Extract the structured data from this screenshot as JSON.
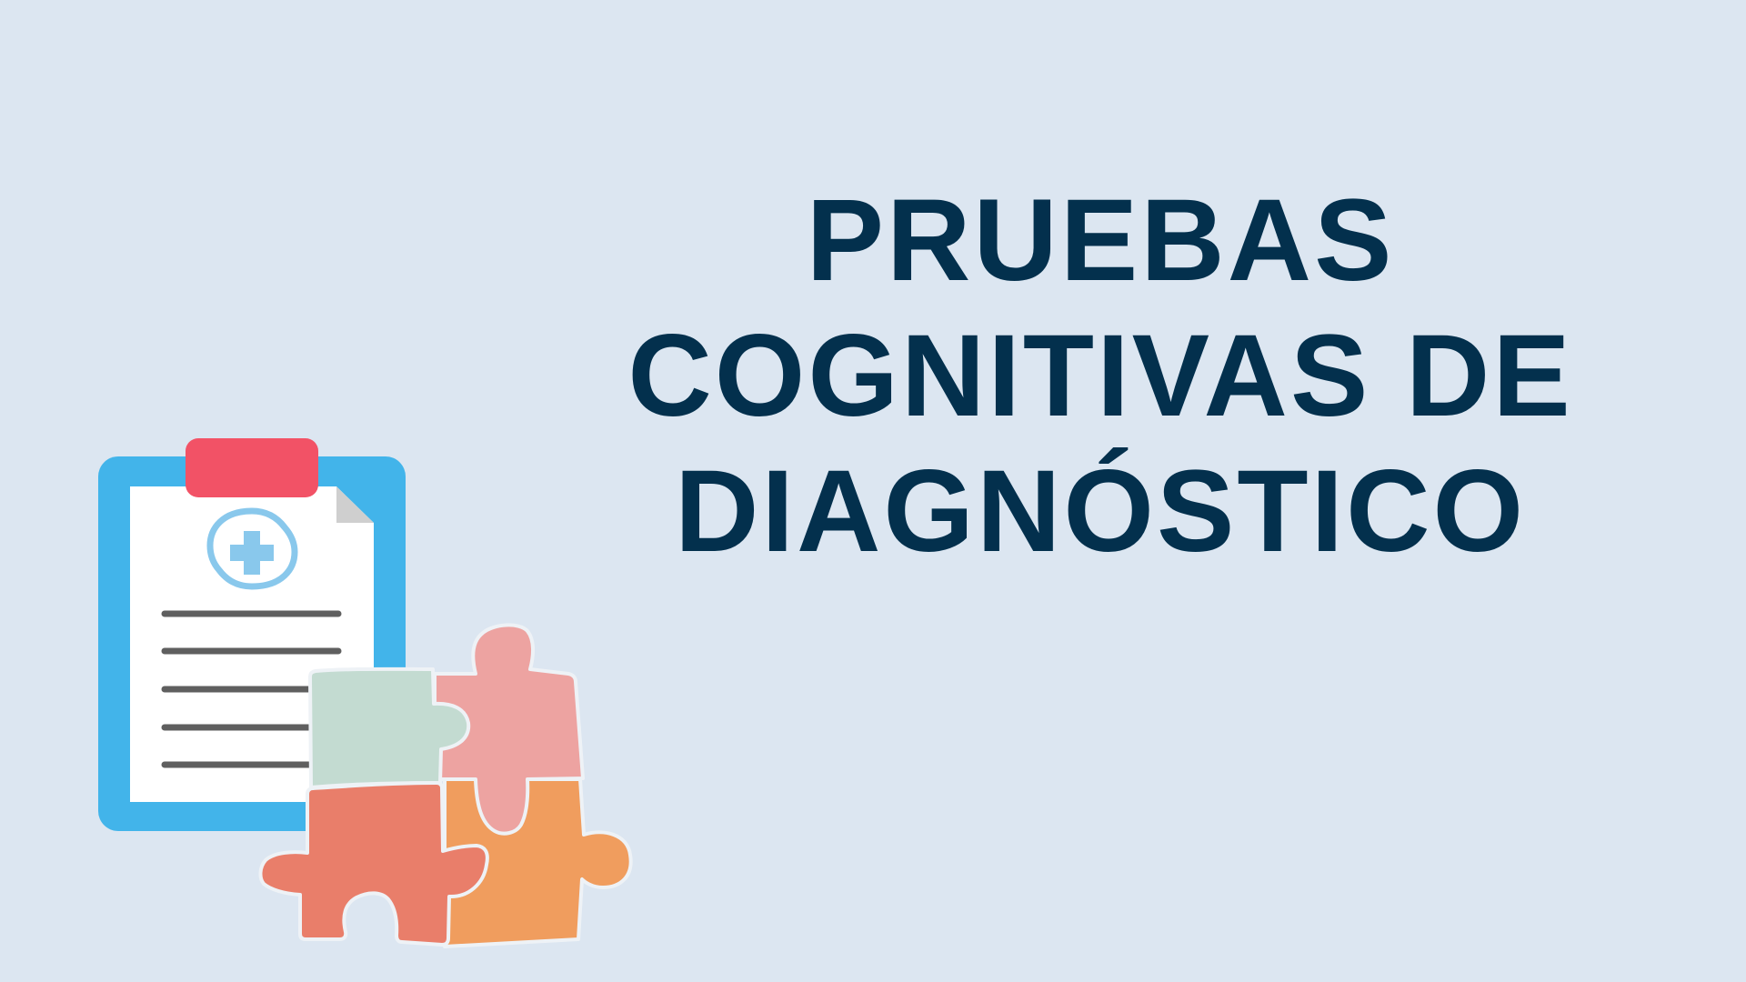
{
  "slide": {
    "title_lines": [
      "PRUEBAS",
      "COGNITIVAS DE",
      "DIAGNÓSTICO"
    ]
  },
  "colors": {
    "background": "#dce6f1",
    "title": "#03304d",
    "clipboard_board": "#42b4ea",
    "clipboard_clip": "#f25266",
    "paper": "#ffffff",
    "medical_cross": "#89c8ec",
    "lines": "#5f5f5f",
    "puzzle_green": "#c3dbd1",
    "puzzle_pink": "#eda3a1",
    "puzzle_orange": "#f09d5e",
    "puzzle_coral": "#e97e6a"
  },
  "icons": [
    "clipboard-icon",
    "medical-cross-icon",
    "puzzle-pieces-icon"
  ]
}
